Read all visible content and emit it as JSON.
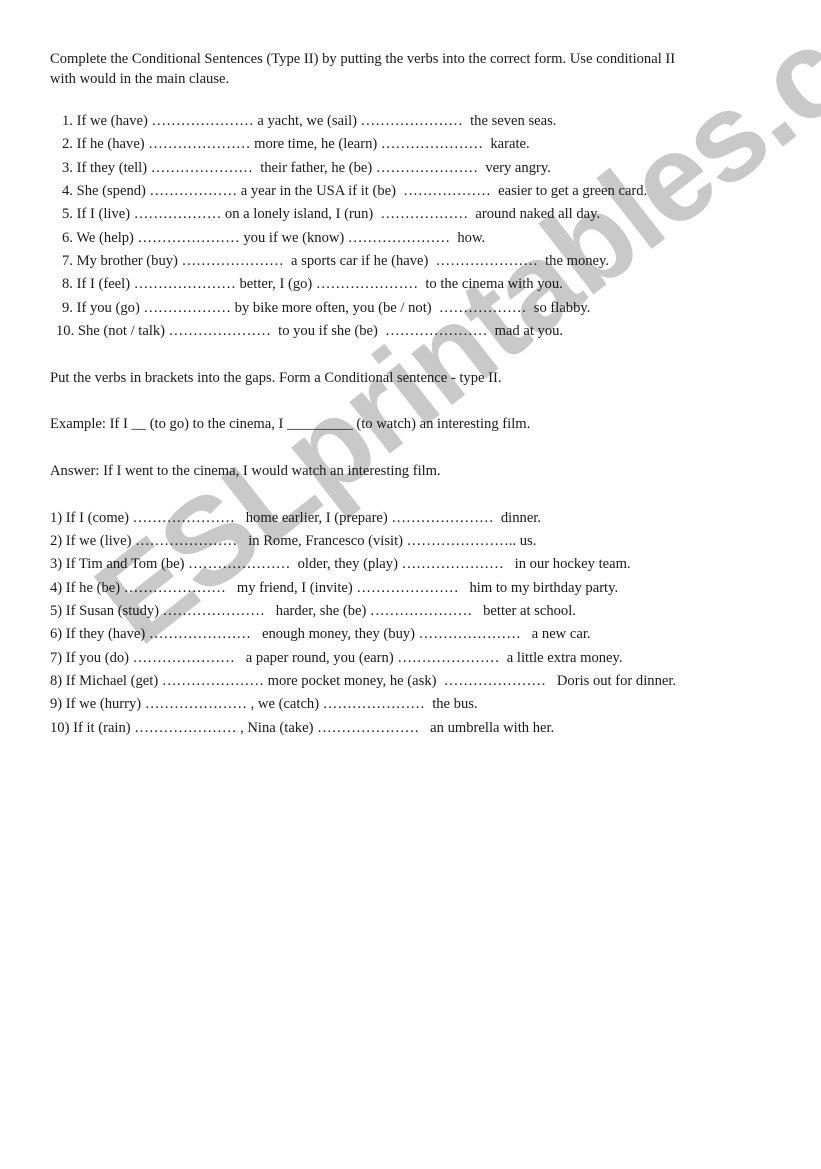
{
  "watermark": "ESLprintables.com",
  "section1": {
    "instruction_line1": "Complete the Conditional Sentences (Type II) by putting the verbs into the correct form. Use conditional II",
    "instruction_line2": "with would in the main clause.",
    "items": [
      "1. If we (have) ………………… a yacht, we (sail) …………………  the seven seas.",
      "2. If he (have) ………………… more time, he (learn) …………………  karate.",
      "3. If they (tell) …………………  their father, he (be) …………………  very angry.",
      "4. She (spend) ……………… a year in the USA if it (be)  ………………  easier to get a green card.",
      "5. If I (live) ……………… on a lonely island, I (run)  ………………  around naked all day.",
      "6. We (help) ………………… you if we (know) …………………  how.",
      "7. My brother (buy) …………………  a sports car if he (have)  …………………  the money.",
      "8. If I (feel) ………………… better, I (go) …………………  to the cinema with you.",
      "9. If you (go) ……………… by bike more often, you (be / not)  ………………  so flabby.",
      "10. She (not / talk) …………………  to you if she (be)  …………………  mad at you."
    ]
  },
  "section2": {
    "instruction": "Put the verbs in brackets into the gaps. Form a Conditional sentence - type II.",
    "example": "Example: If I __ (to go) to the cinema, I _________ (to watch) an interesting film.",
    "answer": "Answer: If I went to the cinema, I would watch an interesting film.",
    "items": [
      "1) If I (come) …………………   home earlier, I (prepare) …………………  dinner.",
      "2) If we (live) …………………   in Rome, Francesco (visit) ………………….. us.",
      "3) If Tim and Tom (be) …………………  older, they (play) …………………   in our hockey team.",
      "4) If he (be) …………………   my friend, I (invite) …………………   him to my birthday party.",
      "5) If Susan (study) …………………   harder, she (be) …………………   better at school.",
      "6) If they (have) …………………   enough money, they (buy) …………………   a new car.",
      "7) If you (do) …………………   a paper round, you (earn) …………………  a little extra money.",
      "8) If Michael (get) ………………… more pocket money, he (ask)  …………………   Doris out for dinner.",
      "9) If we (hurry) ………………… , we (catch) …………………  the bus.",
      "10) If it (rain) ………………… , Nina (take) …………………   an umbrella with her."
    ]
  }
}
